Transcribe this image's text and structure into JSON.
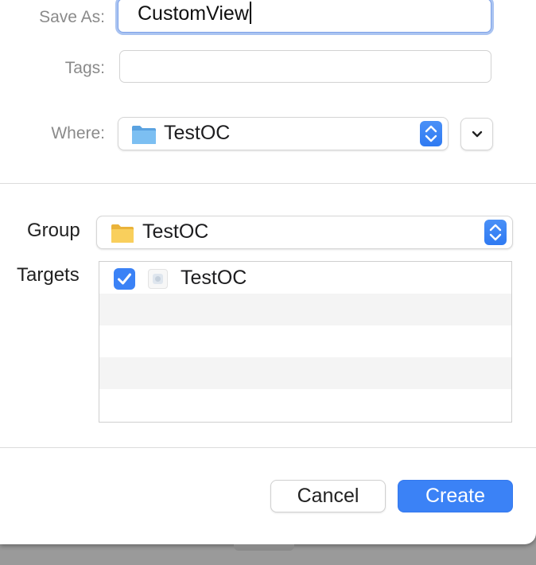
{
  "save_as": {
    "label": "Save As:",
    "value": "CustomView"
  },
  "tags": {
    "label": "Tags:",
    "value": ""
  },
  "where": {
    "label": "Where:",
    "value": "TestOC",
    "icon": "folder-blue-icon"
  },
  "group": {
    "label": "Group",
    "value": "TestOC",
    "icon": "folder-yellow-icon"
  },
  "targets": {
    "label": "Targets",
    "items": [
      {
        "name": "TestOC",
        "checked": true,
        "icon": "app-target-icon"
      }
    ]
  },
  "buttons": {
    "cancel": "Cancel",
    "create": "Create"
  },
  "colors": {
    "accent": "#3b82f6",
    "focus_ring": "#a9c3f1",
    "folder_blue": "#6fb3ea",
    "folder_yellow": "#f7c744"
  }
}
